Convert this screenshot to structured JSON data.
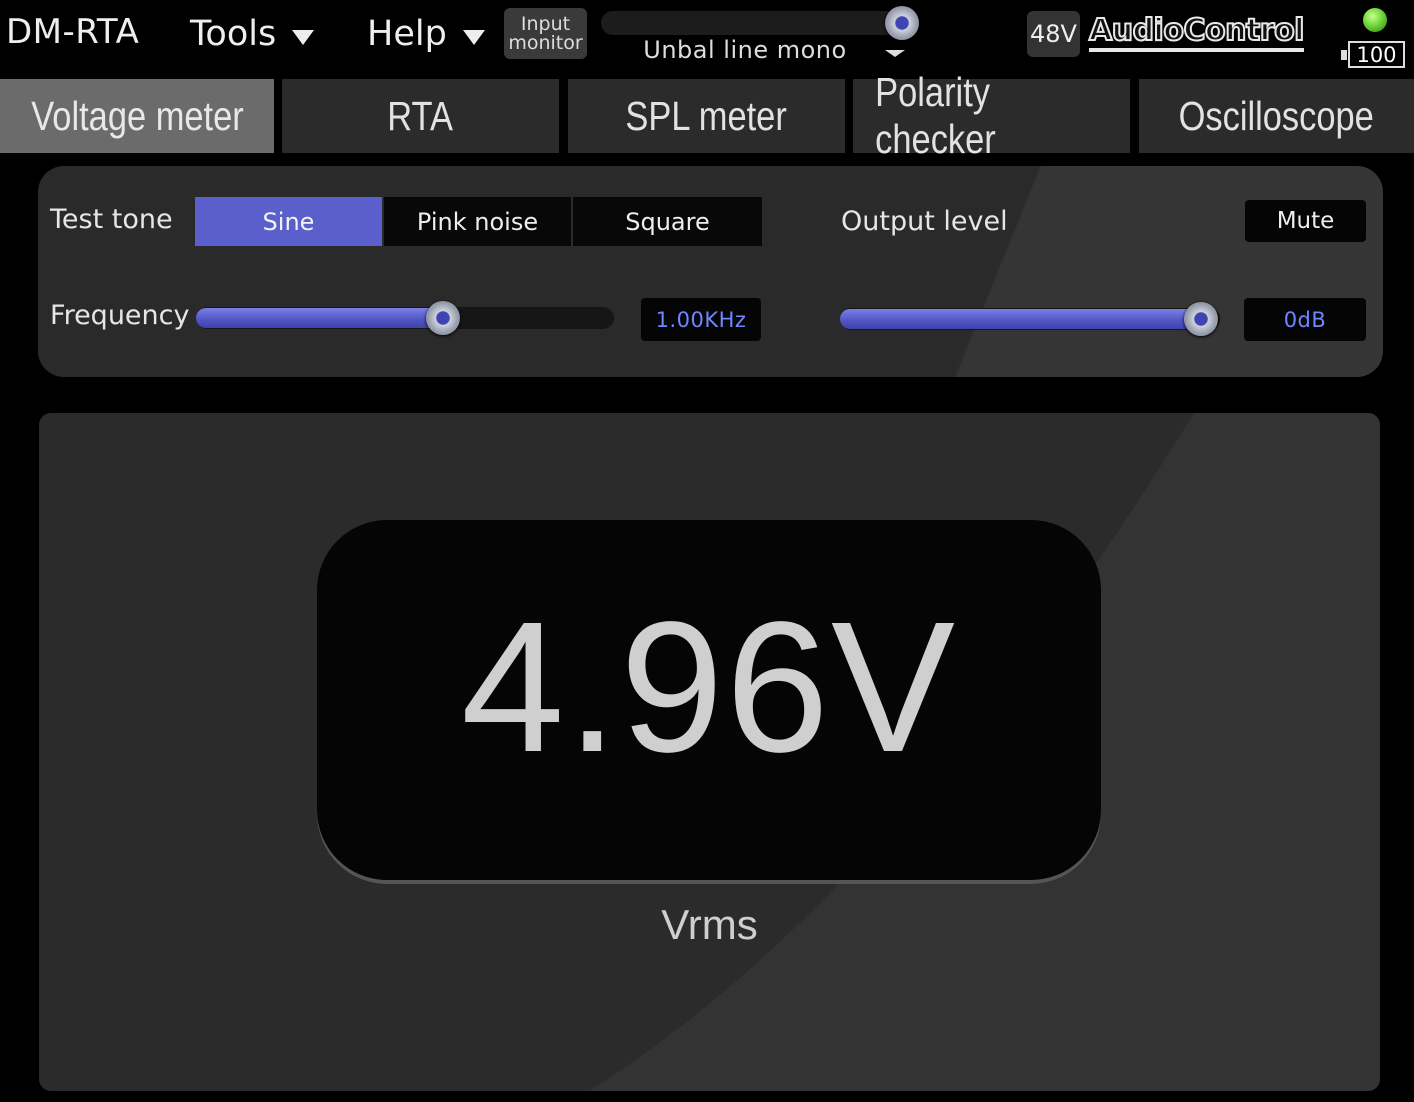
{
  "header": {
    "app_title": "DM-RTA",
    "menus": [
      {
        "label": "Tools"
      },
      {
        "label": "Help"
      }
    ],
    "input_monitor": {
      "line1": "Input",
      "line2": "monitor"
    },
    "input_level": 0.99,
    "input_select": "Unbal line mono",
    "phantom_power": "48V",
    "brand": "AudioControl",
    "battery": "100",
    "status_led_color": "#6fd63a"
  },
  "tabs": [
    {
      "label": "Voltage meter",
      "active": true
    },
    {
      "label": "RTA",
      "active": false
    },
    {
      "label": "SPL meter",
      "active": false
    },
    {
      "label": "Polarity checker",
      "active": false
    },
    {
      "label": "Oscilloscope",
      "active": false
    }
  ],
  "test_tone": {
    "label": "Test tone",
    "options": [
      "Sine",
      "Pink noise",
      "Square"
    ],
    "selected": "Sine",
    "frequency_label": "Frequency",
    "frequency_value": "1.00KHz",
    "frequency_slider": 0.59,
    "output_label": "Output level",
    "mute_label": "Mute",
    "output_value": "0dB",
    "output_slider": 0.95
  },
  "meter": {
    "reading": "4.96V",
    "unit": "Vrms"
  },
  "colors": {
    "accent": "#5a5fcb",
    "value_text": "#6f86ff",
    "active_tab": "#6b6b6b",
    "panel": "#2b2b2b"
  }
}
